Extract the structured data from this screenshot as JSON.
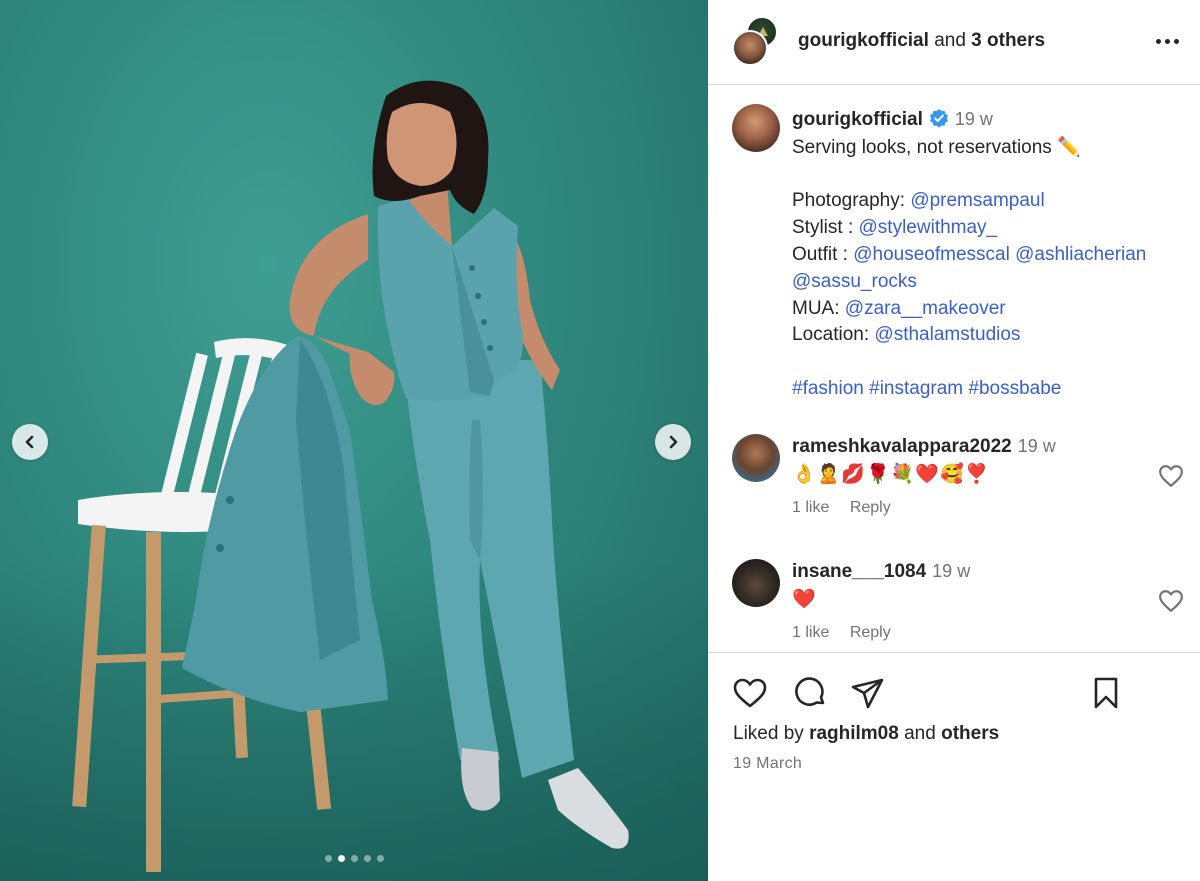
{
  "post": {
    "header": {
      "username": "gourigkofficial",
      "connector": "and",
      "others": "3 others"
    },
    "caption": {
      "username": "gourigkofficial",
      "time": "19 w",
      "text_line1": "Serving looks, not reservations",
      "text_line1_emoji": "✏️",
      "photography_label": "Photography:",
      "photography_link": "@premsampaul",
      "stylist_label": "Stylist :",
      "stylist_link": "@stylewithmay_",
      "outfit_label": "Outfit :",
      "outfit_link1": "@houseofmesscal",
      "outfit_link2": "@ashliacherian",
      "outfit_link3": "@sassu_rocks",
      "mua_label": "MUA:",
      "mua_link": "@zara__makeover",
      "location_label": "Location:",
      "location_link": "@sthalamstudios",
      "hashtags": [
        "#fashion",
        "#instagram",
        "#bossbabe"
      ]
    },
    "comments": [
      {
        "username": "rameshkavalappara2022",
        "time": "19 w",
        "text": "👌🙎💋🌹💐❤️🥰❣️",
        "likes": "1 like",
        "reply": "Reply"
      },
      {
        "username": "insane___1084",
        "time": "19 w",
        "text": "❤️",
        "likes": "1 like",
        "reply": "Reply"
      }
    ],
    "liked_by": {
      "prefix": "Liked by",
      "user": "raghilm08",
      "connector": "and",
      "others": "others"
    },
    "date": "19 March",
    "carousel": {
      "total": 5,
      "active_index": 1
    }
  },
  "icons": {
    "more": "more-horizontal-icon",
    "verified": "verified-badge-icon",
    "like": "heart-icon",
    "comment": "comment-icon",
    "share": "share-icon",
    "save": "bookmark-icon",
    "prev": "chevron-left-icon",
    "next": "chevron-right-icon"
  },
  "colors": {
    "link": "#3a5fc9",
    "verified": "#3897f0",
    "background_teal": "#2f877d"
  }
}
